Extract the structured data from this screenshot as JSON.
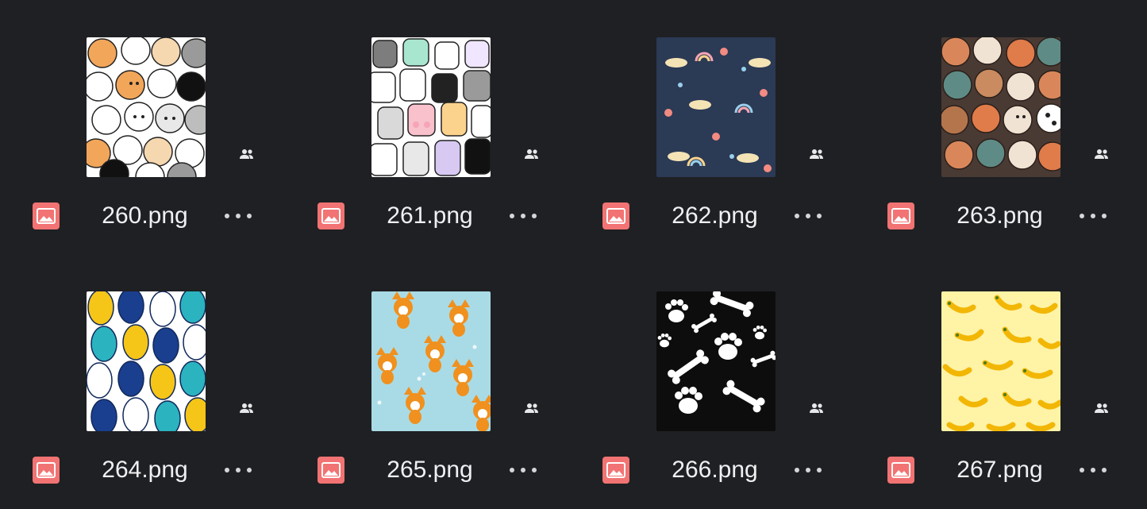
{
  "files": [
    {
      "name": "260.png",
      "pattern": "cats-color",
      "icon": "image-icon",
      "shared_icon": "people-icon"
    },
    {
      "name": "261.png",
      "pattern": "cats-pastel",
      "icon": "image-icon",
      "shared_icon": "people-icon"
    },
    {
      "name": "262.png",
      "pattern": "dogs-rainbows-navy",
      "icon": "image-icon",
      "shared_icon": "people-icon"
    },
    {
      "name": "263.png",
      "pattern": "dogs-brown",
      "icon": "image-icon",
      "shared_icon": "people-icon"
    },
    {
      "name": "264.png",
      "pattern": "dogs-blue-yellow",
      "icon": "image-icon",
      "shared_icon": "people-icon"
    },
    {
      "name": "265.png",
      "pattern": "corgis-lightblue",
      "icon": "image-icon",
      "shared_icon": "people-icon"
    },
    {
      "name": "266.png",
      "pattern": "paws-bones-black",
      "icon": "image-icon",
      "shared_icon": "people-icon"
    },
    {
      "name": "267.png",
      "pattern": "bananas-yellow",
      "icon": "image-icon",
      "shared_icon": "people-icon"
    }
  ],
  "colors": {
    "background": "#1f2023",
    "file_icon": "#f27373",
    "text": "#f0f0f2"
  }
}
